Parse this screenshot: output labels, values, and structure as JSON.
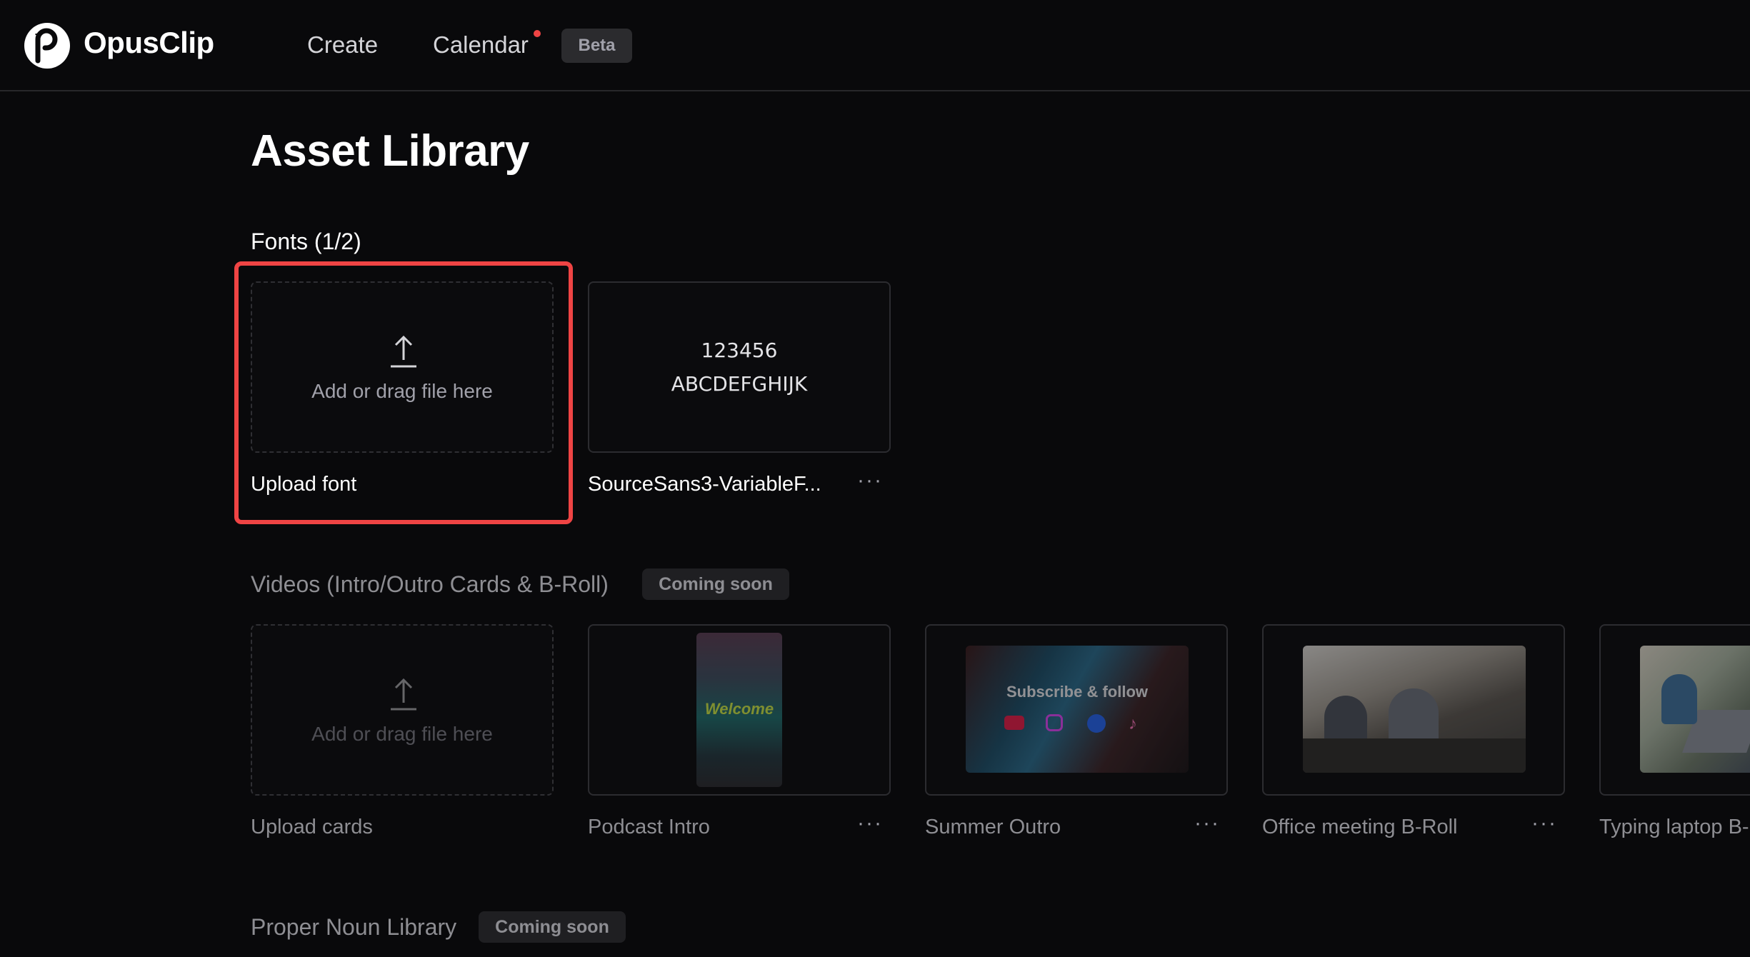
{
  "header": {
    "brand": "OpusClip",
    "nav": {
      "create": "Create",
      "calendar": "Calendar",
      "beta": "Beta"
    }
  },
  "page": {
    "title": "Asset Library"
  },
  "fonts": {
    "title": "Fonts (1/2)",
    "upload": {
      "text": "Add or drag file here",
      "label": "Upload font"
    },
    "items": [
      {
        "preview_line1": "123456",
        "preview_line2": "ABCDEFGHIJK",
        "name": "SourceSans3-VariableF...",
        "more": "···"
      }
    ]
  },
  "videos": {
    "title": "Videos (Intro/Outro Cards & B-Roll)",
    "badge": "Coming soon",
    "upload": {
      "text": "Add or drag file here",
      "label": "Upload cards"
    },
    "items": [
      {
        "name": "Podcast Intro",
        "overlay": "Welcome",
        "more": "···"
      },
      {
        "name": "Summer Outro",
        "overlay": "Subscribe & follow",
        "more": "···"
      },
      {
        "name": "Office meeting B-Roll",
        "more": "···"
      },
      {
        "name": "Typing laptop B-"
      }
    ]
  },
  "proper_noun": {
    "title": "Proper Noun Library",
    "badge": "Coming soon"
  },
  "colors": {
    "background": "#09090b",
    "highlight": "#ef4444",
    "muted": "#8e8e93"
  }
}
